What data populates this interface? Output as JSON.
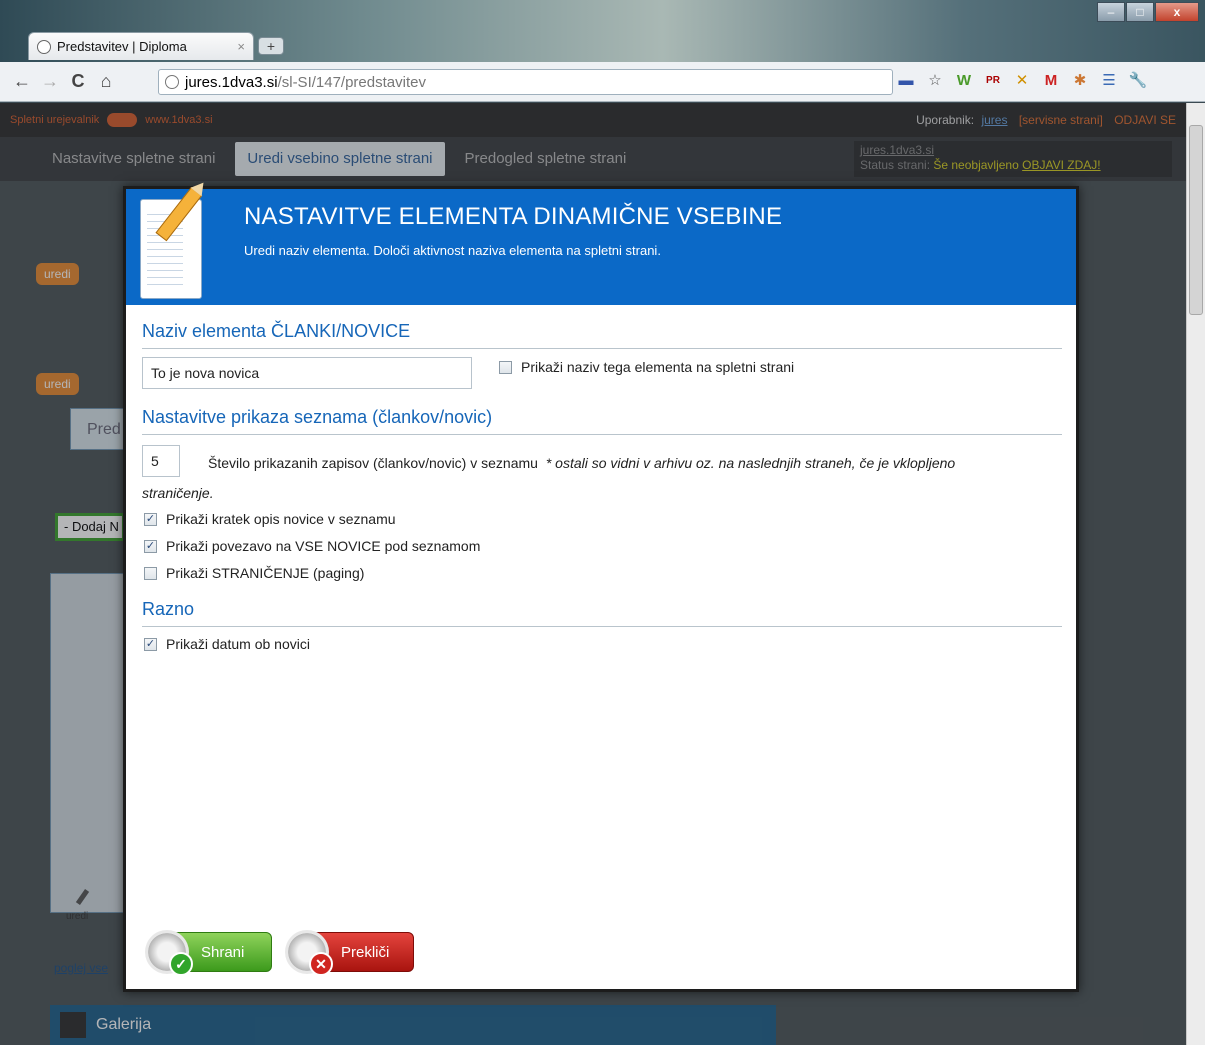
{
  "browser": {
    "tab_title": "Predstavitev | Diploma",
    "tab_close": "×",
    "new_tab": "+",
    "url_host": "jures.1dva3.si",
    "url_path": "/sl-SI/147/predstavitev",
    "nav": {
      "back": "←",
      "forward": "→",
      "reload": "C",
      "home": "⌂"
    },
    "window_buttons": {
      "minimize": "–",
      "maximize": "□",
      "close": "x"
    },
    "extensions": [
      "▬",
      "☆",
      "W",
      "PR",
      "✕",
      "M",
      "✱",
      "☰",
      "🔧"
    ]
  },
  "app": {
    "editor_label": "Spletni urejevalnik",
    "site_label": "www.1dva3.si",
    "user_prefix": "Uporabnik:",
    "user_name": "jures",
    "service_link": "[servisne strani]",
    "logout": "ODJAVI SE",
    "nav_items": [
      "Nastavitve spletne strani",
      "Uredi vsebino spletne strani",
      "Predogled spletne strani"
    ],
    "status_domain": "jures.1dva3.si",
    "status_prefix": "Status strani:",
    "status_value": "Še neobjavljeno",
    "status_link": "OBJAVI ZDAJ!",
    "bg_panel_1": "Galerija",
    "bg_orange_1": "uredi",
    "bg_orange_2": "uredi",
    "bg_dropdown": "- Dodaj N",
    "bg_preview": "Pred",
    "bg_link": "poglej vse",
    "bg_edit": "uredi"
  },
  "dialog": {
    "title": "NASTAVITVE ELEMENTA DINAMIČNE VSEBINE",
    "subtitle": "Uredi naziv elementa. Določi aktivnost naziva elementa na spletni strani.",
    "section_name": "Naziv elementa ČLANKI/NOVICE",
    "name_value": "To je nova novica",
    "show_name_label": "Prikaži naziv tega elementa na spletni strani",
    "section_list": "Nastavitve prikaza seznama (člankov/novic)",
    "count_value": "5",
    "count_label": "Število prikazanih zapisov (člankov/novic) v seznamu",
    "count_note_1": "* ostali so vidni v arhivu oz. na naslednjih straneh, če je vklopljeno",
    "count_note_2": "straničenje.",
    "cb_short_desc": "Prikaži kratek opis novice v seznamu",
    "cb_all_link": "Prikaži povezavo na VSE NOVICE pod seznamom",
    "cb_paging": "Prikaži STRANIČENJE (paging)",
    "section_misc": "Razno",
    "cb_date": "Prikaži datum ob novici",
    "check_mark": "✓",
    "save_label": "Shrani",
    "cancel_label": "Prekliči",
    "save_mark": "✓",
    "cancel_mark": "✕"
  }
}
